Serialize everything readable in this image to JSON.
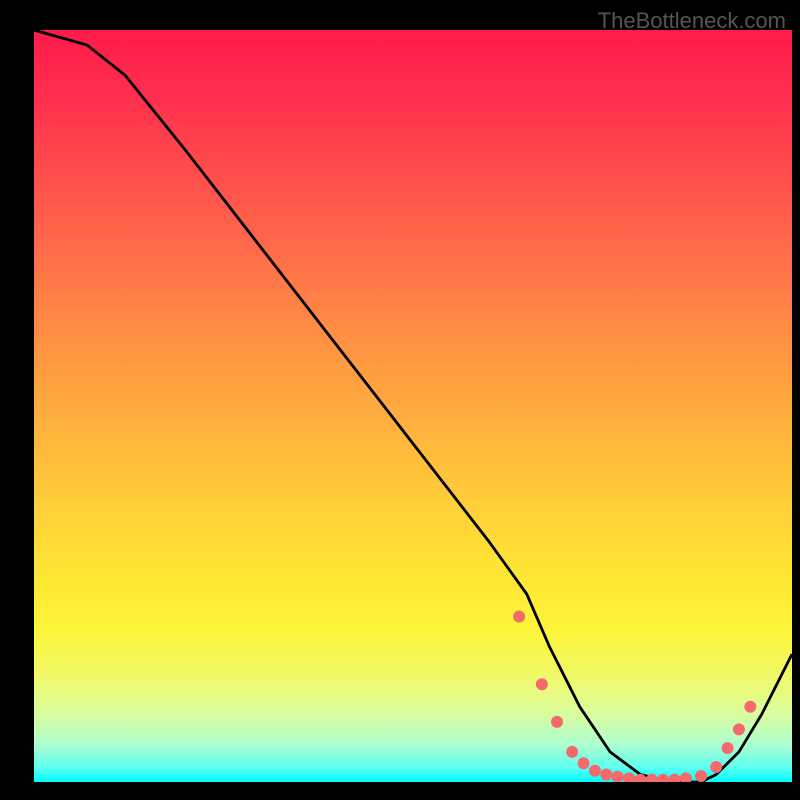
{
  "watermark": "TheBottleneck.com",
  "chart_data": {
    "type": "line",
    "title": "",
    "xlabel": "",
    "ylabel": "",
    "xlim": [
      0,
      100
    ],
    "ylim": [
      0,
      100
    ],
    "series": [
      {
        "name": "curve",
        "x": [
          0,
          7,
          12,
          20,
          30,
          40,
          50,
          60,
          65,
          68,
          72,
          76,
          80,
          84,
          88,
          90,
          93,
          96,
          100
        ],
        "y": [
          100,
          98,
          94,
          84,
          71,
          58,
          45,
          32,
          25,
          18,
          10,
          4,
          1,
          0,
          0,
          1,
          4,
          9,
          17
        ]
      }
    ],
    "dots": {
      "x": [
        64,
        67,
        69,
        71,
        72.5,
        74,
        75.5,
        77,
        78.5,
        80,
        81.5,
        83,
        84.5,
        86,
        88,
        90,
        91.5,
        93,
        94.5
      ],
      "y": [
        22,
        13,
        8,
        4,
        2.5,
        1.5,
        1,
        0.7,
        0.5,
        0.3,
        0.3,
        0.3,
        0.3,
        0.5,
        0.8,
        2,
        4.5,
        7,
        10
      ]
    },
    "colors": {
      "line": "#000000",
      "dots": "#f46a6a"
    }
  }
}
